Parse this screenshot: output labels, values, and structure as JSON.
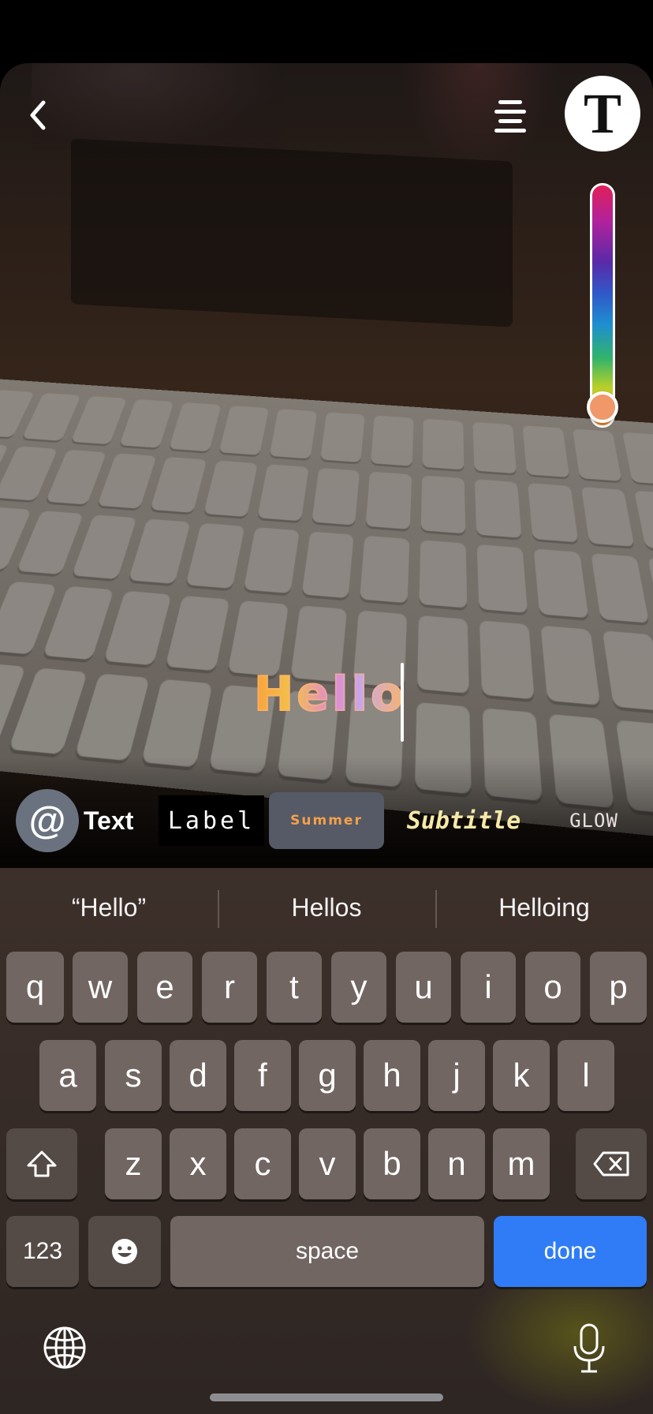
{
  "editor": {
    "back_icon": "chevron-left-icon",
    "align_icon": "text-align-center-icon",
    "font_button_label": "T",
    "color_slider_icon": "color-gradient-slider",
    "color_slider_value": 1.0,
    "selected_color": "#f0986a",
    "input_text": "Hello"
  },
  "styles": {
    "mention_label": "@",
    "items": [
      "Text",
      "Label",
      "Summer",
      "Subtitle",
      "GLOW"
    ],
    "selected": "Summer"
  },
  "keyboard": {
    "suggestions": [
      "“Hello”",
      "Hellos",
      "Helloing"
    ],
    "row1": [
      "q",
      "w",
      "e",
      "r",
      "t",
      "y",
      "u",
      "i",
      "o",
      "p"
    ],
    "row2": [
      "a",
      "s",
      "d",
      "f",
      "g",
      "h",
      "j",
      "k",
      "l"
    ],
    "row3": [
      "z",
      "x",
      "c",
      "v",
      "b",
      "n",
      "m"
    ],
    "shift_icon": "shift-icon",
    "backspace_icon": "backspace-icon",
    "numbers_label": "123",
    "emoji_icon": "emoji-icon",
    "space_label": "space",
    "done_label": "done",
    "globe_icon": "globe-icon",
    "mic_icon": "microphone-icon",
    "done_color": "#2f7cf6"
  }
}
